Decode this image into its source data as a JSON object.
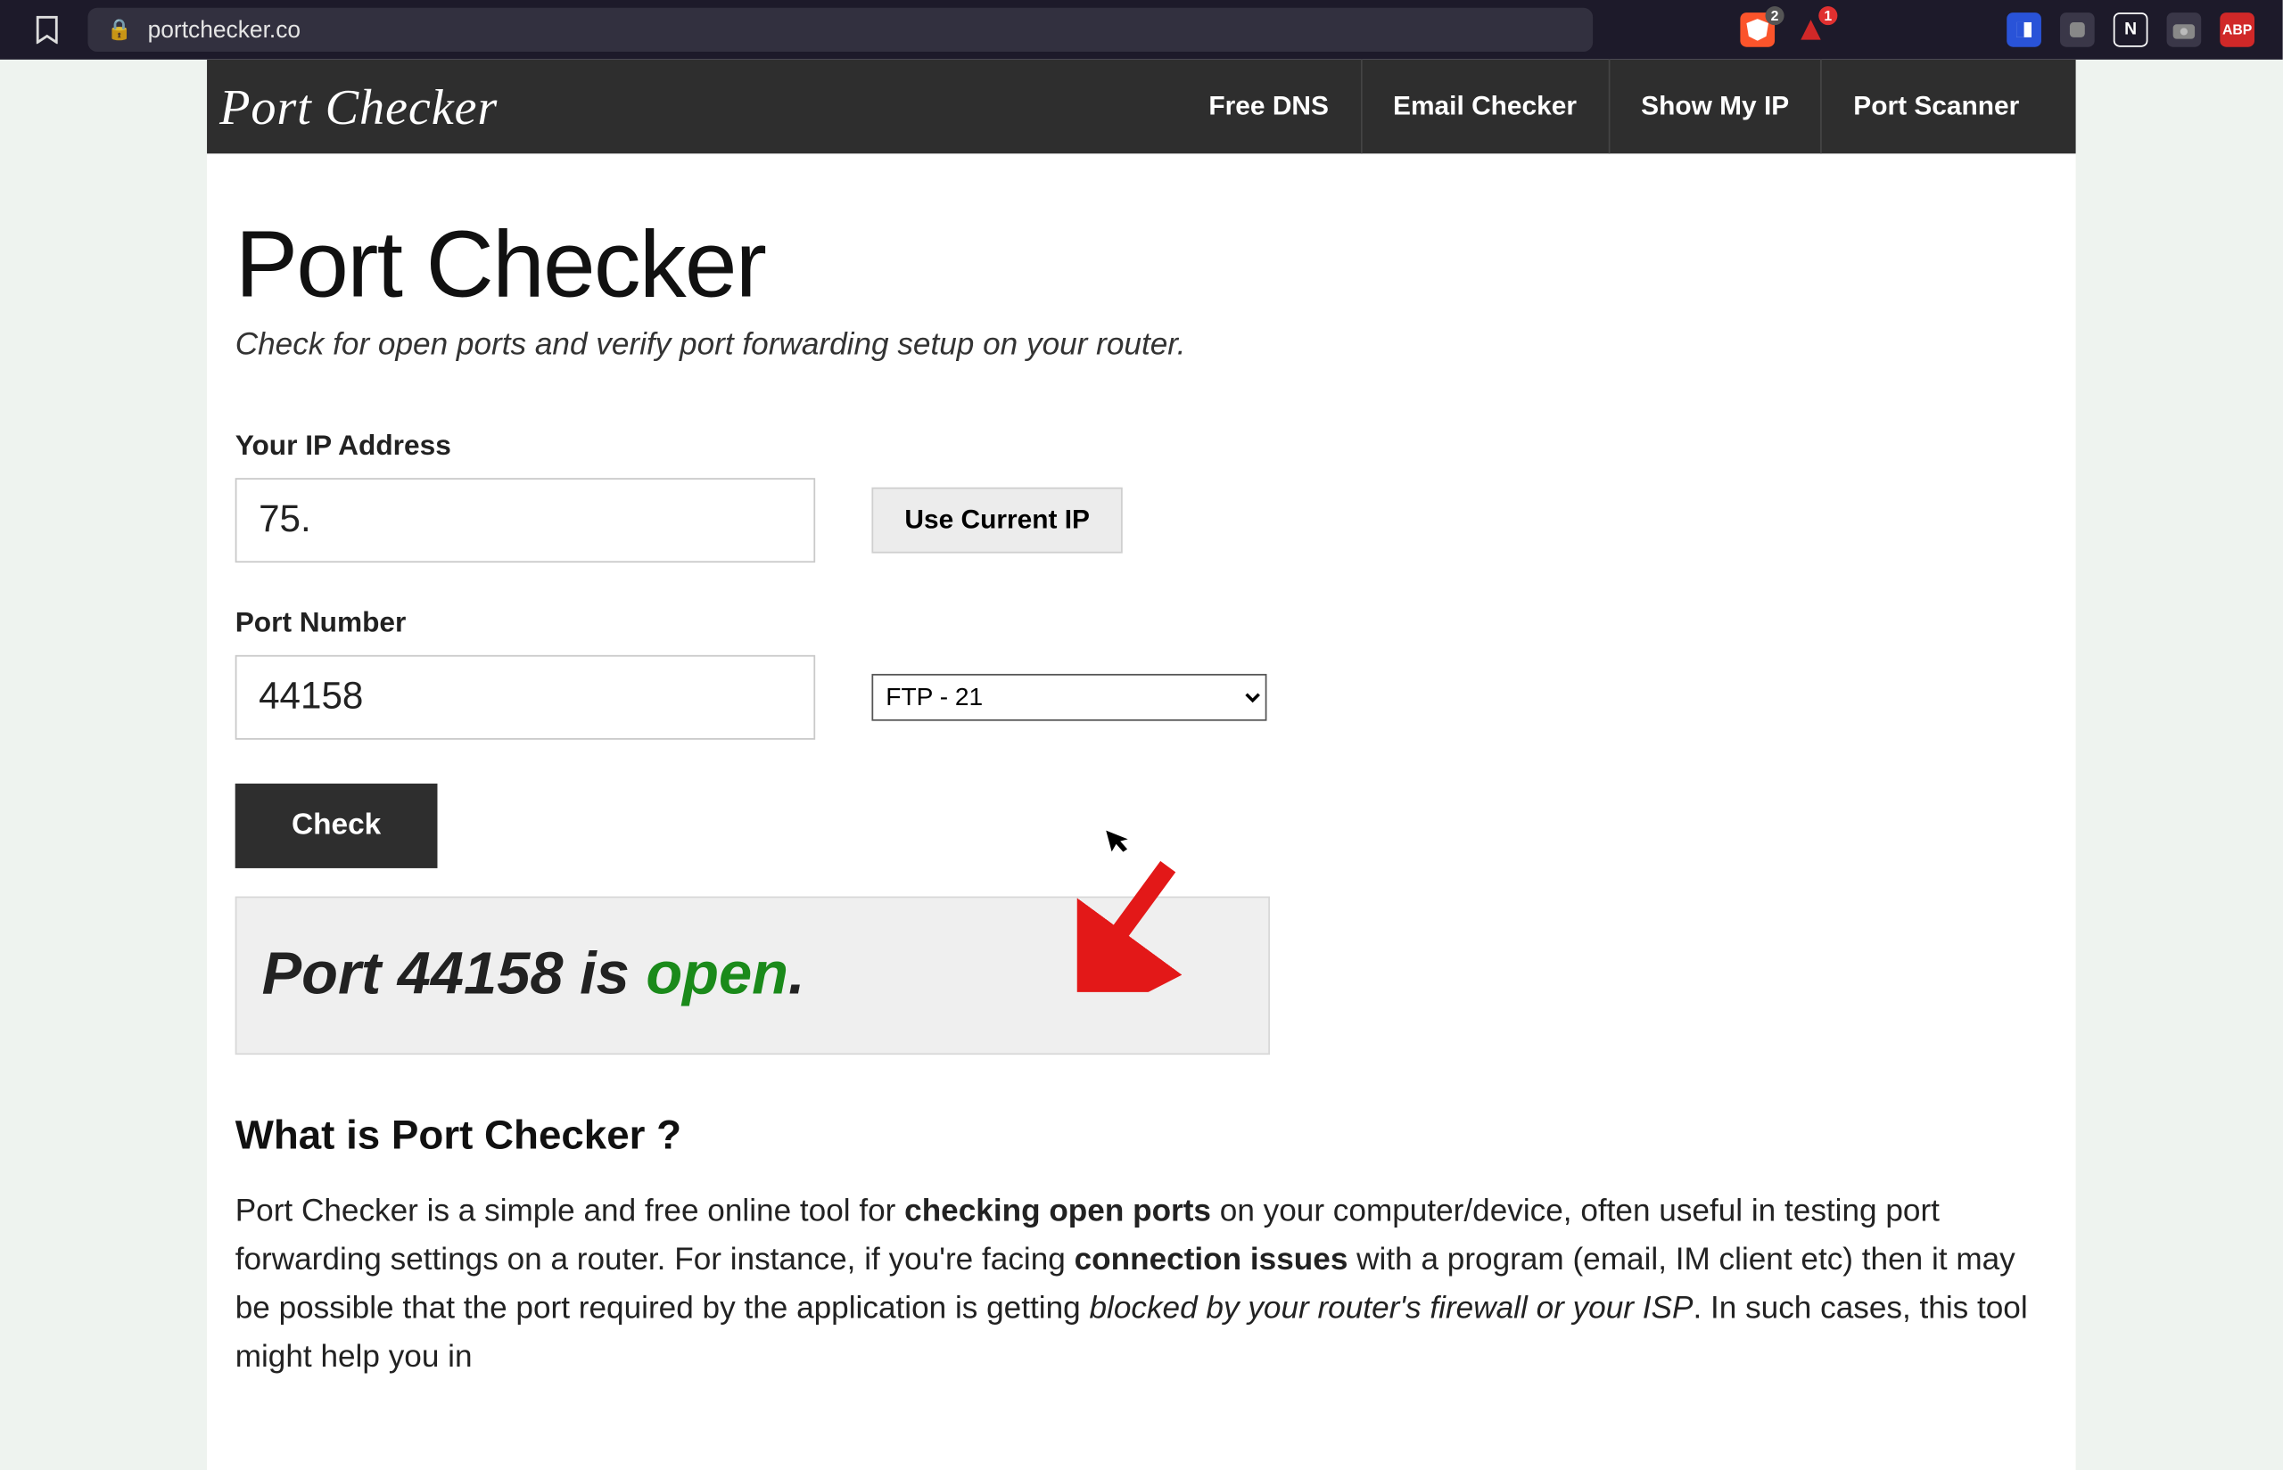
{
  "browser": {
    "url": "portchecker.co",
    "ext_badges": {
      "brave": "2",
      "tri": "1"
    },
    "ext_abp": "ABP"
  },
  "header": {
    "logo": "Port Checker",
    "nav": [
      "Free DNS",
      "Email Checker",
      "Show My IP",
      "Port Scanner"
    ]
  },
  "page": {
    "title": "Port Checker",
    "subtitle": "Check for open ports and verify port forwarding setup on your router."
  },
  "form": {
    "ip_label": "Your IP Address",
    "ip_value": "75.",
    "use_current": "Use Current IP",
    "port_label": "Port Number",
    "port_value": "44158",
    "port_select": "FTP - 21",
    "check": "Check"
  },
  "result": {
    "prefix": "Port 44158 is ",
    "status": "open",
    "suffix": "."
  },
  "about": {
    "heading": "What is Port Checker ?",
    "p1a": "Port Checker is a simple and free online tool for ",
    "p1b": "checking open ports",
    "p1c": " on your computer/device, often useful in testing port forwarding settings on a router. For instance, if you're facing ",
    "p1d": "connection issues",
    "p1e": " with a program (email, IM client etc) then it may be possible that the port required by the application is getting ",
    "p1f": "blocked by your router's firewall or your ISP",
    "p1g": ". In such cases, this tool might help you in"
  }
}
